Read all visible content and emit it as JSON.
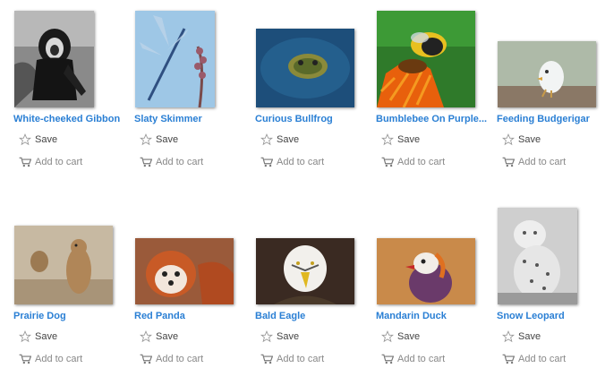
{
  "photos": [
    {
      "title": "White-cheeked Gibbon",
      "save_label": "Save",
      "cart_label": "Add to cart"
    },
    {
      "title": "Slaty Skimmer",
      "save_label": "Save",
      "cart_label": "Add to cart"
    },
    {
      "title": "Curious Bullfrog",
      "save_label": "Save",
      "cart_label": "Add to cart"
    },
    {
      "title": "Bumblebee On Purple...",
      "save_label": "Save",
      "cart_label": "Add to cart"
    },
    {
      "title": "Feeding Budgerigar",
      "save_label": "Save",
      "cart_label": "Add to cart"
    },
    {
      "title": "Prairie Dog",
      "save_label": "Save",
      "cart_label": "Add to cart"
    },
    {
      "title": "Red Panda",
      "save_label": "Save",
      "cart_label": "Add to cart"
    },
    {
      "title": "Bald Eagle",
      "save_label": "Save",
      "cart_label": "Add to cart"
    },
    {
      "title": "Mandarin Duck",
      "save_label": "Save",
      "cart_label": "Add to cart"
    },
    {
      "title": "Snow Leopard",
      "save_label": "Save",
      "cart_label": "Add to cart"
    }
  ],
  "colors": {
    "link": "#2a7fd4",
    "action_text": "#555555"
  },
  "icons": {
    "save": "star-icon",
    "cart": "shopping-cart-icon"
  }
}
